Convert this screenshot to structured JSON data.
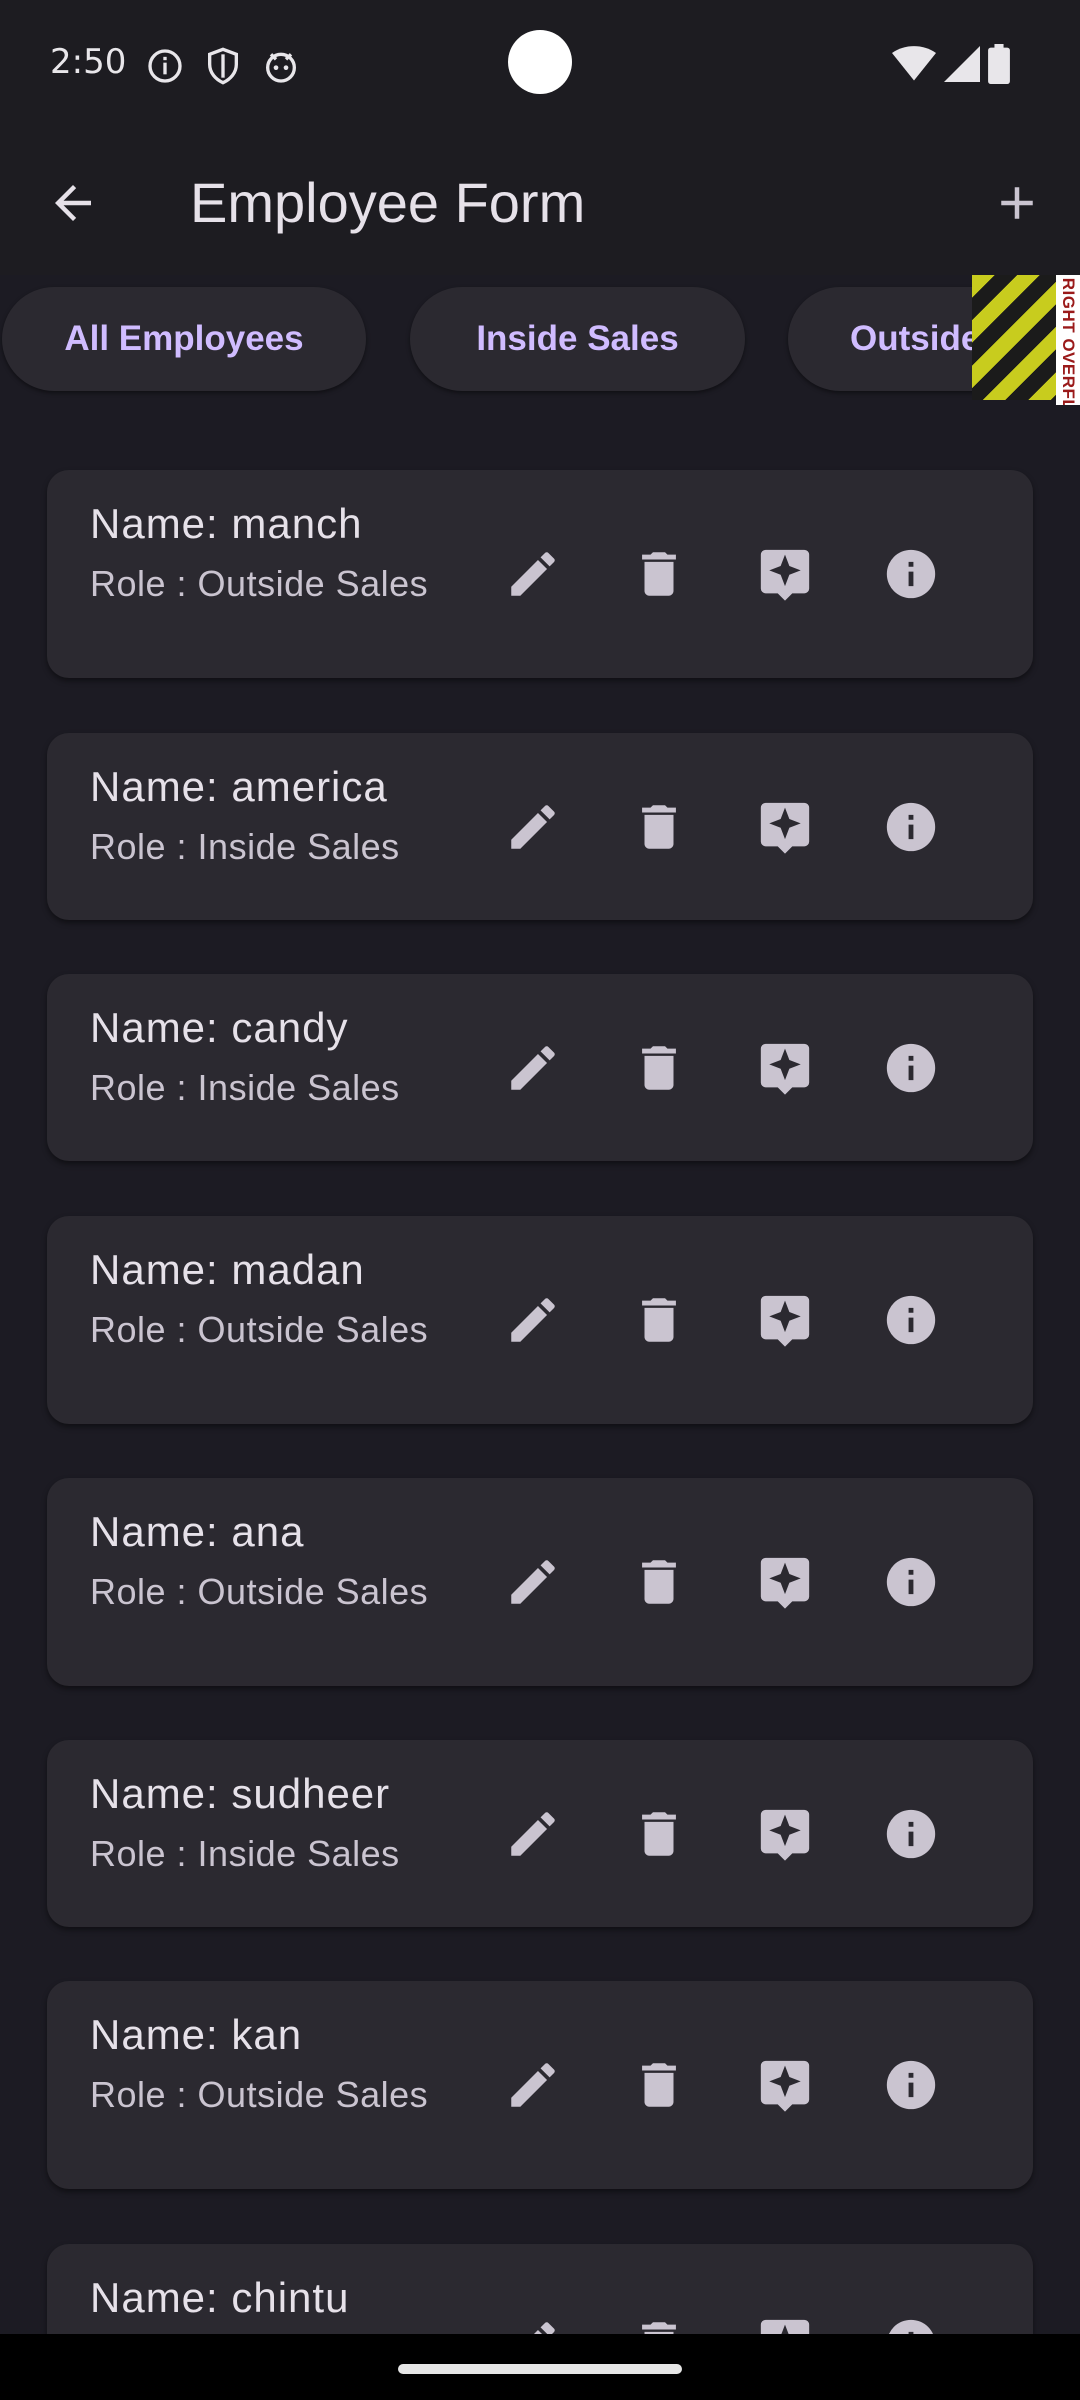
{
  "status": {
    "time": "2:50"
  },
  "app_bar": {
    "title": "Employee Form"
  },
  "tabs": [
    {
      "label": "All Employees"
    },
    {
      "label": "Inside Sales"
    },
    {
      "label": "Outside Sales"
    }
  ],
  "overflow_label": "RIGHT OVERFLOWED BY",
  "employees": [
    {
      "name": "Name: manch",
      "role": "Role : Outside Sales"
    },
    {
      "name": "Name: america",
      "role": "Role : Inside Sales"
    },
    {
      "name": "Name: candy",
      "role": "Role : Inside Sales"
    },
    {
      "name": "Name: madan",
      "role": "Role : Outside Sales"
    },
    {
      "name": "Name: ana",
      "role": "Role : Outside Sales"
    },
    {
      "name": "Name: sudheer",
      "role": "Role : Inside Sales"
    },
    {
      "name": "Name: kan",
      "role": "Role : Outside Sales"
    },
    {
      "name": "Name: chintu",
      "role": ""
    }
  ],
  "icons": {
    "back": "arrow-back-icon",
    "add": "add-icon",
    "edit": "pencil-icon",
    "delete": "trash-icon",
    "review": "sparkle-feedback-icon",
    "info": "info-icon"
  },
  "colors": {
    "background": "#1c1b23",
    "card": "#2b2930",
    "accent": "#d0bcff",
    "icon": "#cac4d0"
  }
}
